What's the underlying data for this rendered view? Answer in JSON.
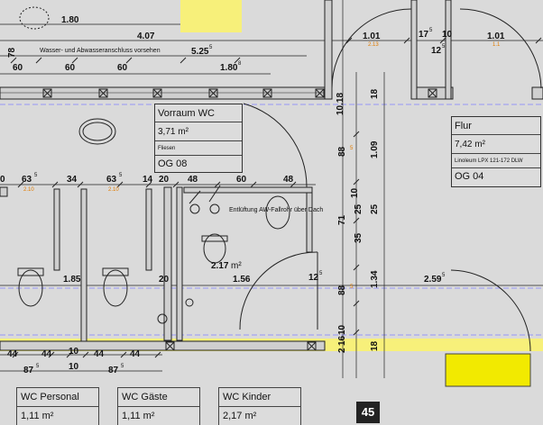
{
  "colors": {
    "background": "#dadada",
    "highlight": "#f7f07a",
    "door_fill": "#f2ea00",
    "line": "#222222",
    "dim_orange": "#e07b00",
    "gridline_blue": "#8080ff"
  },
  "top_dims": {
    "d_1_80": "1.80",
    "d_4_07": "4.07",
    "d_5_25": "5.25",
    "d_5_25_sup": "5",
    "d_1_80b": "1.80",
    "d_1_80b_sup": "8",
    "d_78": "78",
    "d_60a": "60",
    "d_60b": "60",
    "d_60c": "60",
    "d_1_01a": "1.01",
    "d_1_01a_sub": "2.13",
    "d_17": "17",
    "d_17_sup": "5",
    "d_10": "10",
    "d_12": "12",
    "d_12_sup": "5",
    "d_1_01b": "1.01",
    "d_1_01b_sub": "1.1"
  },
  "note_water": "Wasser- und Abwasseranschluss vorsehen",
  "note_vent": "Entlüftung AW-Fallrohr über Dach",
  "mid_dims": {
    "d_63a": "63",
    "d_63a_sup": "5",
    "d_34": "34",
    "d_63b": "63",
    "d_63b_sup": "5",
    "d_14": "14",
    "d_20": "20",
    "d_48a": "48",
    "d_60": "60",
    "d_48b": "48",
    "d_0": "0",
    "o_a": "2.10",
    "o_b": "2.10",
    "d_1_85": "1.85",
    "d_20b": "20",
    "d_2_17": "2.17",
    "d_2_17_unit": "m²",
    "d_1_56": "1.56",
    "d_12b": "12",
    "d_12b_sup": "5",
    "d_2_59": "2.59",
    "d_2_59_sup": "5"
  },
  "vert_dims": {
    "v_10_18": "10.18",
    "v_18a": "18",
    "v_88a": "88",
    "v_88a_sup": "5",
    "v_1_09": "1.09",
    "v_10": "10",
    "v_25a": "25",
    "v_25b": "25",
    "v_71": "71",
    "v_35": "35",
    "v_35_sup": "5",
    "v_88b": "88",
    "v_88b_sup": "5",
    "v_1_34": "1.34",
    "v_216": "2",
    "v_10b": "16",
    "v_10c": "10",
    "v_18b": "18",
    "o_v": "2.10"
  },
  "bottom_dims": {
    "b_44a": "44",
    "b_44b": "44",
    "b_10a": "10",
    "b_44c": "44",
    "b_44d": "44",
    "b_87a": "87",
    "b_87a_sup": "5",
    "b_10b": "10",
    "b_87b": "87",
    "b_87b_sup": "5"
  },
  "room_vorraum": {
    "name": "Vorraum WC",
    "area": "3,71 m²",
    "material": "Fliesen",
    "code": "OG 08"
  },
  "room_flur": {
    "name": "Flur",
    "area": "7,42 m²",
    "material": "Linoleum LPX 121-172 DLW",
    "code": "OG 04"
  },
  "room_wc_personal": {
    "name": "WC Personal",
    "area": "1,11 m²"
  },
  "room_wc_gaeste": {
    "name": "WC Gäste",
    "area": "1,11 m²"
  },
  "room_wc_kinder": {
    "name": "WC Kinder",
    "area": "2,17 m²"
  },
  "page_number": "45"
}
